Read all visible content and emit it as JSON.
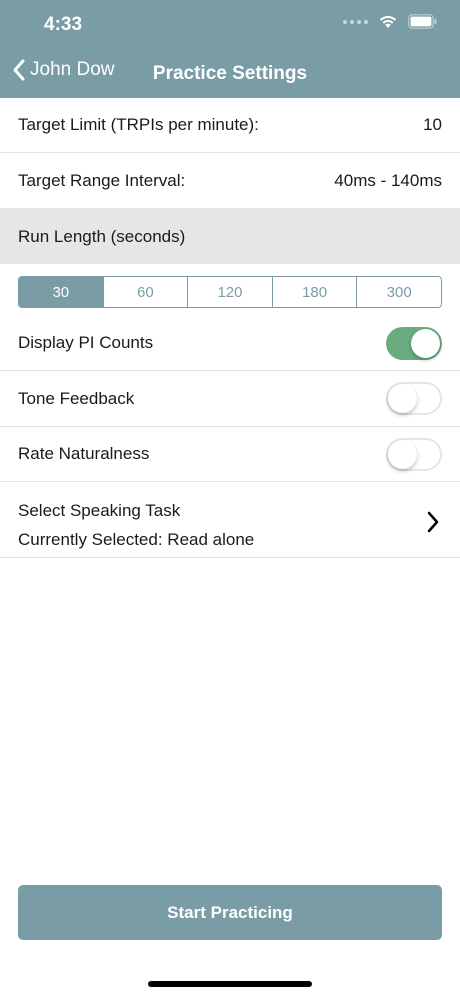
{
  "status_bar": {
    "time": "4:33",
    "signal_icon": "cellular-signal-icon",
    "wifi_icon": "wifi-icon",
    "battery_icon": "battery-icon"
  },
  "nav": {
    "back_label": "John Dow",
    "back_icon": "chevron-left-icon",
    "title": "Practice Settings"
  },
  "settings": {
    "target_limit": {
      "label": "Target Limit (TRPIs per minute):",
      "value": "10"
    },
    "target_range": {
      "label": "Target Range Interval:",
      "value": "40ms - 140ms"
    }
  },
  "run_length": {
    "header": "Run Length (seconds)",
    "options": [
      "30",
      "60",
      "120",
      "180",
      "300"
    ],
    "selected": "30"
  },
  "toggles": {
    "display_pi": {
      "label": "Display PI Counts",
      "on": true
    },
    "tone_feedback": {
      "label": "Tone Feedback",
      "on": false
    },
    "rate_naturalness": {
      "label": "Rate Naturalness",
      "on": false
    }
  },
  "speaking_task": {
    "title": "Select Speaking Task",
    "current": "Currently Selected: Read alone",
    "chevron_icon": "chevron-right-icon"
  },
  "start_button": {
    "label": "Start Practicing"
  },
  "colors": {
    "header_bg": "#7a9ca5",
    "accent": "#7a9ca5",
    "toggle_on": "#6aab80",
    "section_bg": "#e6e6e8",
    "divider": "#e2e2e2"
  }
}
